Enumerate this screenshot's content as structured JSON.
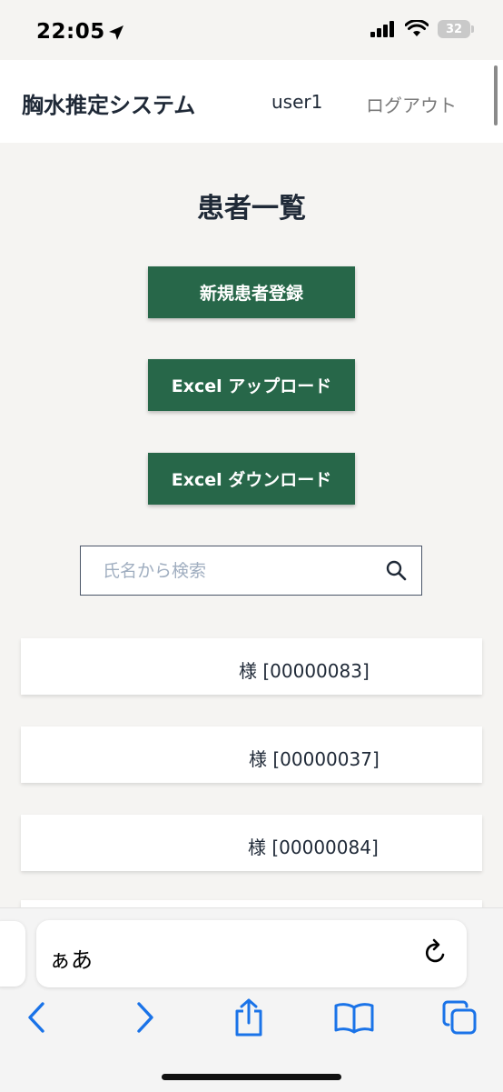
{
  "status_bar": {
    "time": "22:05",
    "battery": "32"
  },
  "header": {
    "title": "胸水推定システム",
    "username": "user1",
    "logout": "ログアウト"
  },
  "main": {
    "title": "患者一覧",
    "buttons": {
      "new_patient": "新規患者登録",
      "excel_upload": "Excel アップロード",
      "excel_download": "Excel ダウンロード"
    },
    "search": {
      "placeholder": "氏名から検索",
      "value": ""
    },
    "patients": [
      {
        "label": "様 [00000083]"
      },
      {
        "label": "様 [00000037]"
      },
      {
        "label": "様 [00000084]"
      }
    ]
  },
  "browser": {
    "address_text": "ぁあ"
  },
  "colors": {
    "accent": "#276749",
    "ios_blue": "#1a73e8"
  }
}
